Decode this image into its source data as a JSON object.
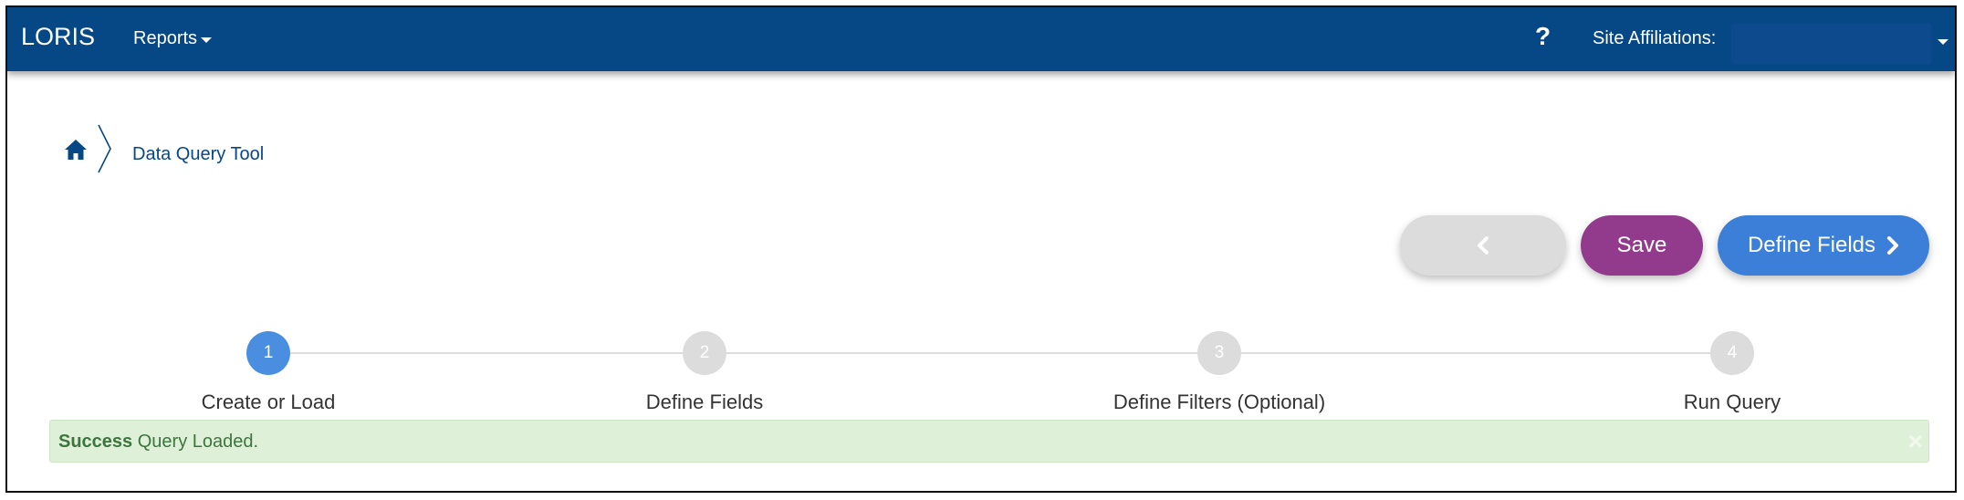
{
  "navbar": {
    "brand": "LORIS",
    "reports_label": "Reports",
    "help_symbol": "?",
    "site_affiliations_label": "Site Affiliations:",
    "site_affiliations_value": ""
  },
  "breadcrumb": {
    "home_icon": "home-icon",
    "current": "Data Query Tool"
  },
  "actions": {
    "back_icon": "chevron-left-icon",
    "save_label": "Save",
    "next_label": "Define Fields",
    "next_icon": "chevron-right-icon"
  },
  "stepper": {
    "current_step": 1,
    "steps": [
      {
        "number": "1",
        "label": "Create or Load"
      },
      {
        "number": "2",
        "label": "Define Fields"
      },
      {
        "number": "3",
        "label": "Define Filters (Optional)"
      },
      {
        "number": "4",
        "label": "Run Query"
      }
    ]
  },
  "alert": {
    "title": "Success",
    "message": " Query Loaded.",
    "close_symbol": "×"
  },
  "colors": {
    "navbar": "#064785",
    "save_button": "#923b8c",
    "next_button": "#3c7fd9",
    "active_step": "#4a8fdf",
    "alert_bg": "#dff0d8",
    "alert_text": "#3c763d"
  }
}
